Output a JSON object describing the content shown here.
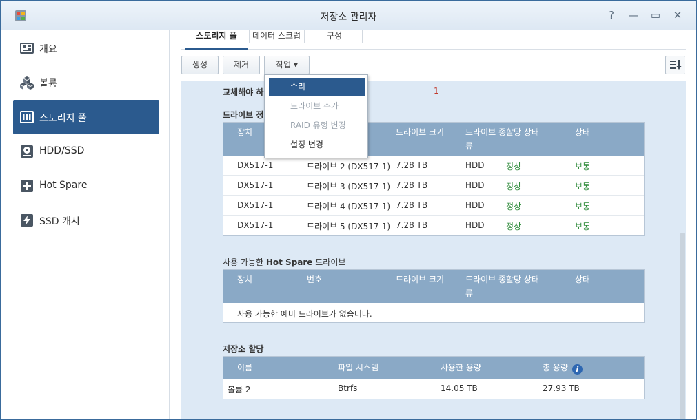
{
  "window": {
    "title": "저장소 관리자",
    "help_glyph": "?",
    "minimize_glyph": "—",
    "maximize_glyph": "▭",
    "close_glyph": "✕"
  },
  "sidebar": {
    "items": [
      {
        "label": "개요",
        "icon": "overview-icon"
      },
      {
        "label": "볼륨",
        "icon": "volume-icon"
      },
      {
        "label": "스토리지 풀",
        "icon": "storage-pool-icon",
        "active": true
      },
      {
        "label": "HDD/SSD",
        "icon": "hdd-icon"
      },
      {
        "label": "Hot Spare",
        "icon": "hot-spare-icon"
      },
      {
        "label": "SSD 캐시",
        "icon": "ssd-cache-icon"
      }
    ]
  },
  "tabs": [
    {
      "label": "스토리지 풀",
      "active": true
    },
    {
      "label": "데이터 스크럽"
    },
    {
      "label": "구성"
    }
  ],
  "toolbar": {
    "create_label": "생성",
    "remove_label": "제거",
    "action_label": "작업 ▾"
  },
  "dropdown": {
    "items": [
      {
        "label": "수리",
        "highlighted": true
      },
      {
        "label": "드라이브 추가",
        "disabled": true
      },
      {
        "label": "RAID 유형 변경",
        "disabled": true
      },
      {
        "label": "설정 변경"
      }
    ]
  },
  "content": {
    "replace_label": "교체해야 하",
    "replace_value": "1",
    "drive_info_label": "드라이브 정",
    "drive_table": {
      "headers": [
        "장치",
        "드라이브 크기",
        "드라이브 종할당 상태",
        "류",
        "상태"
      ],
      "rows": [
        [
          "DX517-1",
          "드라이브 2 (DX517-1)",
          "7.28 TB",
          "HDD",
          "정상",
          "보통"
        ],
        [
          "DX517-1",
          "드라이브 3 (DX517-1)",
          "7.28 TB",
          "HDD",
          "정상",
          "보통"
        ],
        [
          "DX517-1",
          "드라이브 4 (DX517-1)",
          "7.28 TB",
          "HDD",
          "정상",
          "보통"
        ],
        [
          "DX517-1",
          "드라이브 5 (DX517-1)",
          "7.28 TB",
          "HDD",
          "정상",
          "보통"
        ]
      ]
    },
    "hotspare_title_prefix": "사용 가능한 ",
    "hotspare_title_bold": "Hot Spare",
    "hotspare_title_suffix": " 드라이브",
    "hotspare_table": {
      "headers": [
        "장치",
        "번호",
        "드라이브 크기",
        "드라이브 종할당 상태",
        "류",
        "상태"
      ],
      "empty_text": "사용 가능한 예비 드라이브가 없습니다."
    },
    "allocation_title": "저장소 할당",
    "allocation_table": {
      "headers": [
        "이름",
        "파일 시스템",
        "사용한 용량",
        "총 용량"
      ],
      "info_glyph": "i",
      "rows": [
        [
          "볼륨 2",
          "Btrfs",
          "14.05 TB",
          "27.93 TB"
        ]
      ]
    }
  },
  "colors": {
    "accent": "#2b5a8e",
    "table_header": "#8aa9c6",
    "content_bg": "#dde9f5",
    "status_green": "#2e8b3a",
    "warning_red": "#c0392b"
  }
}
